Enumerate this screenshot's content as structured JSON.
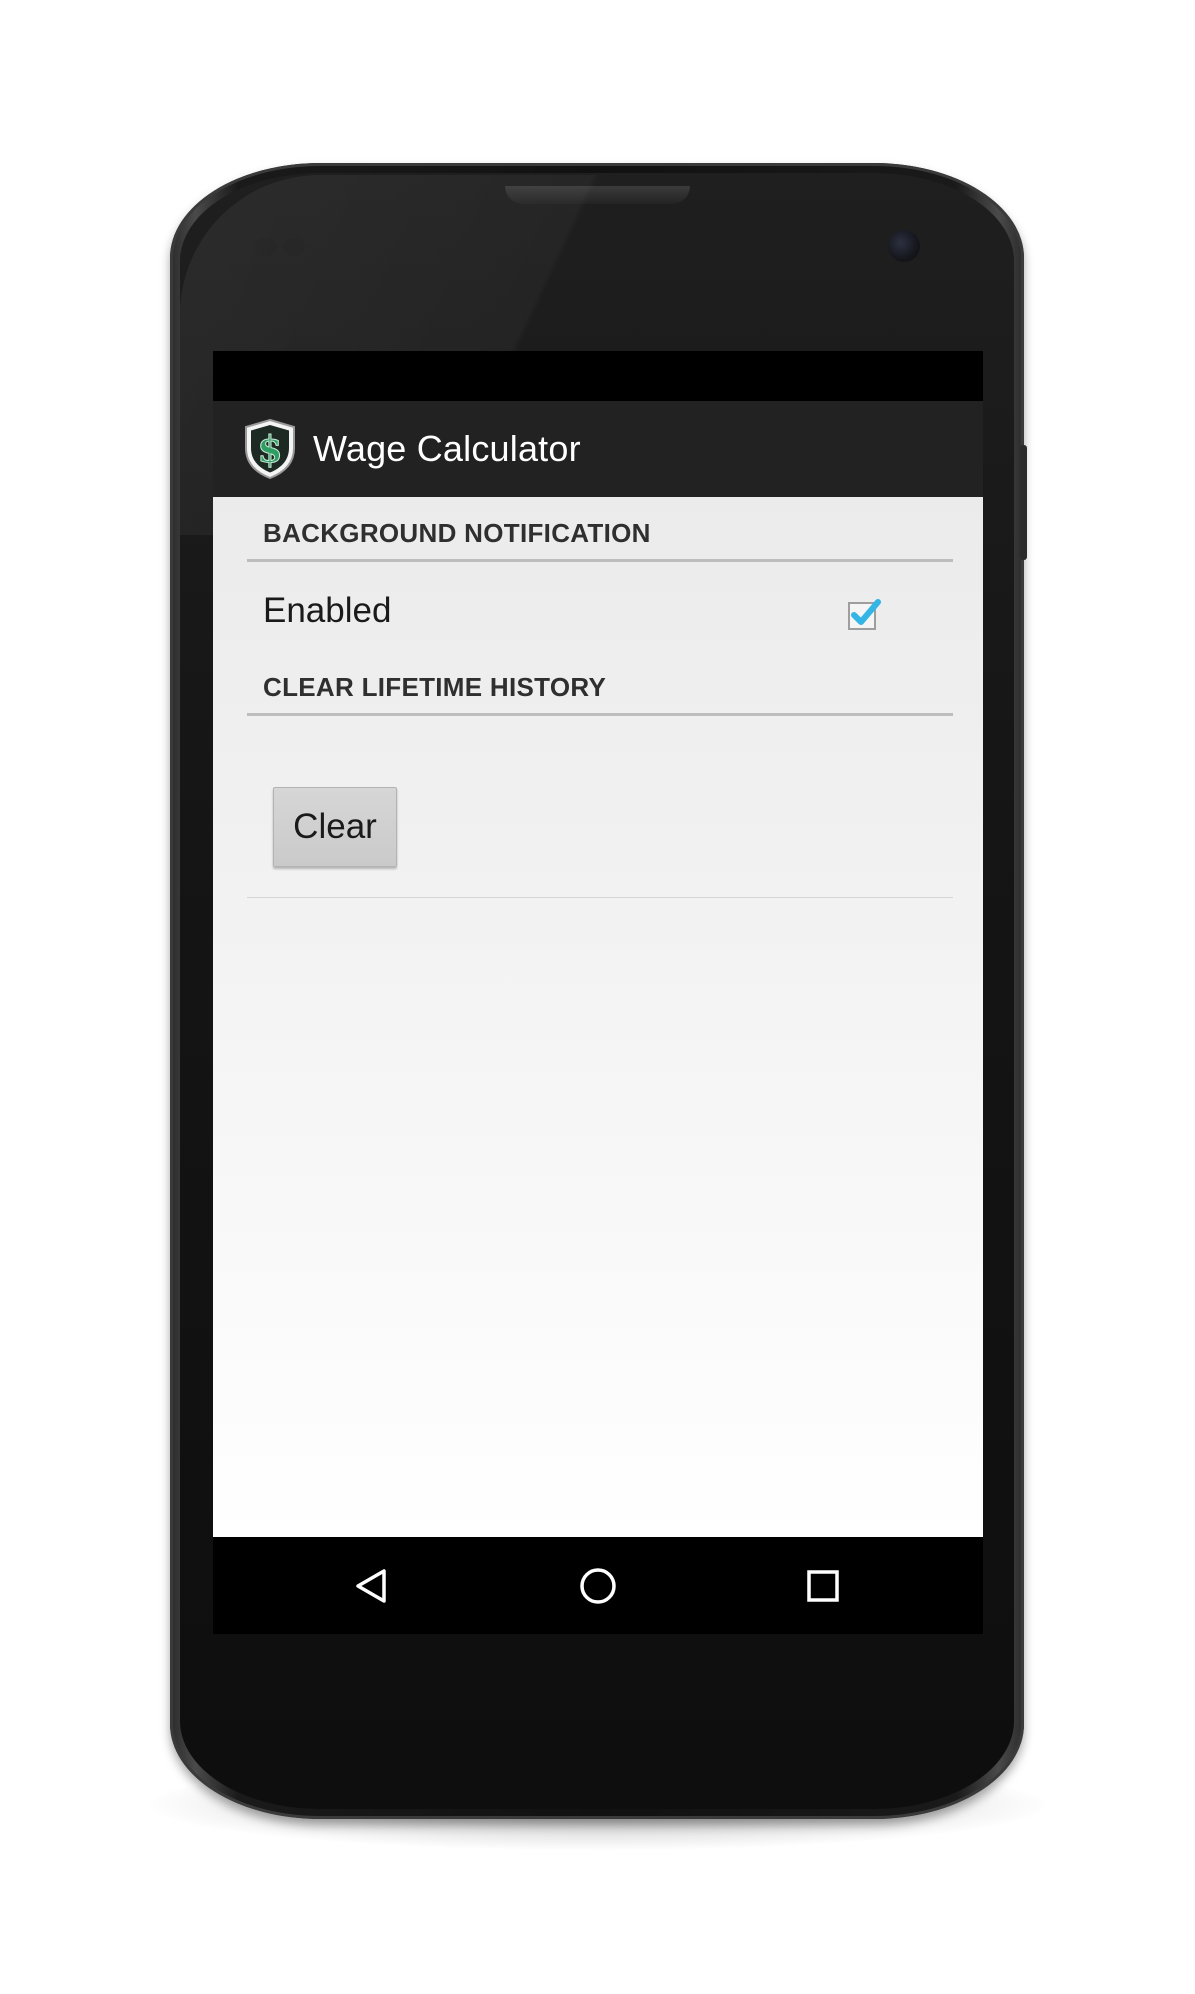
{
  "app": {
    "title": "Wage Calculator",
    "icon": "dollar-shield-icon"
  },
  "sections": [
    {
      "header": "BACKGROUND NOTIFICATION",
      "pref_label": "Enabled",
      "checked": true
    },
    {
      "header": "CLEAR LIFETIME HISTORY",
      "button_label": "Clear"
    }
  ],
  "nav": {
    "back_icon": "back-triangle-icon",
    "home_icon": "home-circle-icon",
    "recents_icon": "recents-square-icon"
  },
  "colors": {
    "action_bar": "#222222",
    "checkbox_accent": "#33b5e5",
    "icon_green": "#1b7a4a"
  }
}
